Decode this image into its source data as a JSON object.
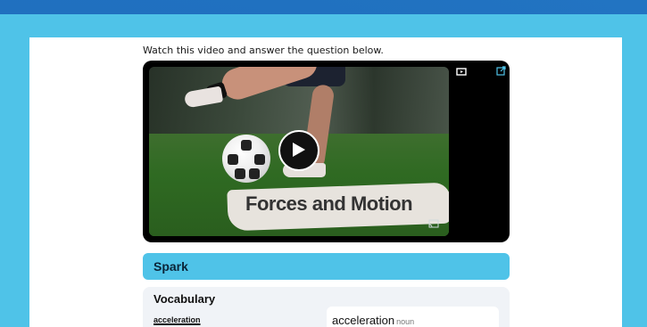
{
  "instruction": "Watch this video and answer the question below.",
  "video": {
    "title": "Forces and Motion",
    "play_icon": "play-icon",
    "cast_icon": "cast-icon",
    "tv_icon": "tv-icon",
    "external_icon": "external-link-icon"
  },
  "spark": {
    "label": "Spark"
  },
  "vocabulary": {
    "heading": "Vocabulary",
    "term": "acceleration",
    "definition_word": "acceleration",
    "part_of_speech": "noun"
  },
  "colors": {
    "page_background": "#1e6dbd",
    "accent": "#4fc3e8",
    "panel": "#f0f3f7"
  }
}
